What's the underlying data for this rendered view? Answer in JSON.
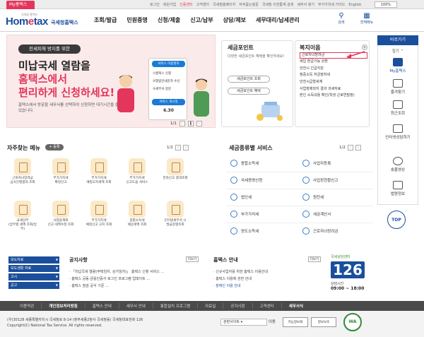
{
  "topbar": {
    "my_tab": "My홈택스",
    "links": [
      "로그인",
      "회원가입",
      "인증센터",
      "고객센터",
      "국세청홈페이지",
      "자주묻는질문",
      "국세청 이전통계 검색",
      "세무서 찾기",
      "부가가치세 가이드",
      "English"
    ],
    "zoom": "100%"
  },
  "header": {
    "logo_small": "국세청 홈택스",
    "logo_hom": "Hom",
    "logo_e": "e",
    "logo_tax": "tax",
    "logo_kr": "국세청홈택스",
    "menu": [
      "조회/발급",
      "민원증명",
      "신청/제출",
      "신고/납부",
      "상담/제보",
      "세무대리/납세관리"
    ],
    "search_label": "검색",
    "allmenu_label": "전체메뉴"
  },
  "banner": {
    "pill": "전세피해 방지를 위한",
    "line1": "미납국세 열람을",
    "line2": "홈택스에서",
    "line3": "편리하게 신청하세요!",
    "desc": "홈택스에서 방문할 세무서를 선택하여 신청하면 대기시간을 줄일 수 있습니다.",
    "card_title": "서비스 이용절차",
    "card_steps": [
      "①홈택스 신청",
      "②열람안내문자 수신",
      "③세무서 방문"
    ],
    "card_btn": "서비스 개시일",
    "card_date": "6.30",
    "page": "1/1"
  },
  "tax_point": {
    "title": "세금포인트",
    "desc": "다양한 세금포인트 혜택을 확인하세요!",
    "btn1": "세금포인트 조회",
    "btn2": "세금포인트 혜택"
  },
  "welfare": {
    "title": "복지이음",
    "items": [
      "근로자녀장려금",
      "세입 환급가능 상환",
      "안전시 긴급지원",
      "청중소득 저금장려세",
      "안천시급형세계",
      "사업장제외지 결과 과세자료",
      "본인 소득내용 확인(학생 근로연말정)"
    ]
  },
  "quick": {
    "title": "바로가기",
    "fold": "접기",
    "items": [
      "My홈택스",
      "즐겨찾기",
      "최근조회",
      "인터넷상담하기",
      "숏폼영상",
      "법령정보"
    ],
    "top": "TOP"
  },
  "freq_menu": {
    "title": "자주찾는 메뉴",
    "pill": "+ 등록",
    "page": "1/2",
    "items": [
      "근로자녀장려금\n심사진행결과 조회",
      "부가가치세\n확정신고",
      "부가가치세\n예정고지세액 조회",
      "부가가치세\n신고도움 서비스",
      "전자신고 결과조회",
      "국세납부\n(납부할 세액 조회/납부)",
      "사업용계좌\n신고 세액수정 조회",
      "부가가치세\n예정신고 고지 조회",
      "종합소득세\n예상세액 조회",
      "인터넷세무서 시\n발급증명조회"
    ]
  },
  "tax_services": {
    "title": "세금종류별 서비스",
    "page": "1/2",
    "items": [
      "종합소득세",
      "사업자등록",
      "국세증명신청",
      "사업장현황신고",
      "법인세",
      "원천세",
      "부가가치세",
      "세금계산서",
      "양도소득세",
      "근로자녀장려금"
    ]
  },
  "side_links": [
    "보도자료",
    "보도생활 자료",
    "고시",
    "공고"
  ],
  "notice": {
    "title": "공지사항",
    "more": "더보기",
    "items": [
      "「미납국세 열람(주택임차, 상가임차)」 홈택스 신청 서비스 ...",
      "홈택스 공동·금융인증서 로그인 프로그램 업데이트 ...",
      "홈택스 점검 공식 기준 ..."
    ]
  },
  "hometax_info": {
    "title": "홈택스 안내",
    "more": "더보기",
    "items": [
      "신규사업자를 위한 홈택스 이용안내",
      "홈택스 이용에 관한 안내",
      "장애인 이용 안내"
    ]
  },
  "call_center": {
    "label": "국세상담센터",
    "number": "126",
    "hours_label": "상담시간",
    "hours": "09:00 ~ 18:00"
  },
  "footer": {
    "nav": [
      "이용약관",
      "개인정보처리방침",
      "홈택스 안내",
      "세무서 안내",
      "통합설치 프로그램",
      "자료실",
      "공지사항",
      "고객센터",
      "세무서식"
    ],
    "selected_nav": "개인정보처리방침",
    "address": "(우)30128 세종특별자치시 국세청로 8-14 (정부세종2청사 국세청동) 국세청대표전화 126",
    "copyright": "Copyright(C) National Tax Service. All rights reserved.",
    "related_site": "관련사이트",
    "go": "이동",
    "badge1": "지능정보화",
    "badge2": "정보보호",
    "badge3": "WA"
  },
  "colors": {
    "accent_red": "#e4355a",
    "brand_blue": "#1b4f9c"
  }
}
